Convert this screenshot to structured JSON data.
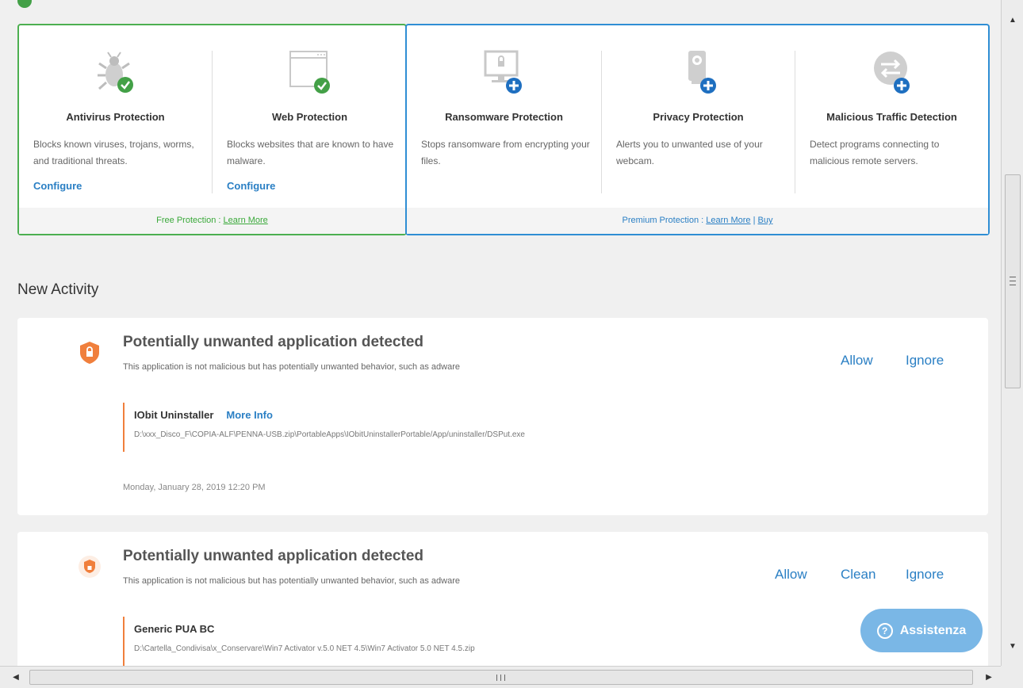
{
  "free_panel": {
    "features": [
      {
        "title": "Antivirus Protection",
        "desc": "Blocks known viruses, trojans, worms, and traditional threats.",
        "link": "Configure",
        "icon": "bug-check-icon"
      },
      {
        "title": "Web Protection",
        "desc": "Blocks websites that are known to have malware.",
        "link": "Configure",
        "icon": "browser-check-icon"
      }
    ],
    "footer_prefix": "Free Protection : ",
    "footer_learn": "Learn More",
    "border_color": "#4caf50"
  },
  "premium_panel": {
    "features": [
      {
        "title": "Ransomware Protection",
        "desc": "Stops ransomware from encrypting your files.",
        "icon": "monitor-lock-plus-icon"
      },
      {
        "title": "Privacy Protection",
        "desc": "Alerts you to unwanted use of your webcam.",
        "icon": "webcam-plus-icon"
      },
      {
        "title": "Malicious Traffic Detection",
        "desc": "Detect programs connecting to malicious remote servers.",
        "icon": "traffic-plus-icon"
      }
    ],
    "footer_prefix": "Premium Protection : ",
    "footer_learn": "Learn More",
    "footer_sep": " | ",
    "footer_buy": "Buy",
    "border_color": "#2f8ed4"
  },
  "activity": {
    "heading": "New Activity",
    "items": [
      {
        "title": "Potentially unwanted application detected",
        "subtitle": "This application is not malicious but has potentially unwanted behavior, such as adware",
        "name": "IObit Uninstaller",
        "more_info": "More Info",
        "path": "D:\\xxx_Disco_F\\COPIA-ALF\\PENNA-USB.zip\\PortableApps\\IObitUninstallerPortable/App/uninstaller/DSPut.exe",
        "date": "Monday, January 28, 2019 12:20 PM",
        "actions": [
          "Allow",
          "Ignore"
        ]
      },
      {
        "title": "Potentially unwanted application detected",
        "subtitle": "This application is not malicious but has potentially unwanted behavior, such as adware",
        "name": "Generic PUA BC",
        "path": "D:\\Cartella_Condivisa\\x_Conservare\\Win7 Activator v.5.0 NET 4.5\\Win7 Activator 5.0 NET 4.5.zip",
        "actions": [
          "Allow",
          "Clean",
          "Ignore"
        ]
      }
    ]
  },
  "help_button": {
    "label": "Assistenza",
    "icon": "question-circle-icon"
  },
  "colors": {
    "accent": "#2a7fc4",
    "green": "#43a047",
    "orange": "#f07f3c",
    "help_bg": "#7ab7e6"
  }
}
